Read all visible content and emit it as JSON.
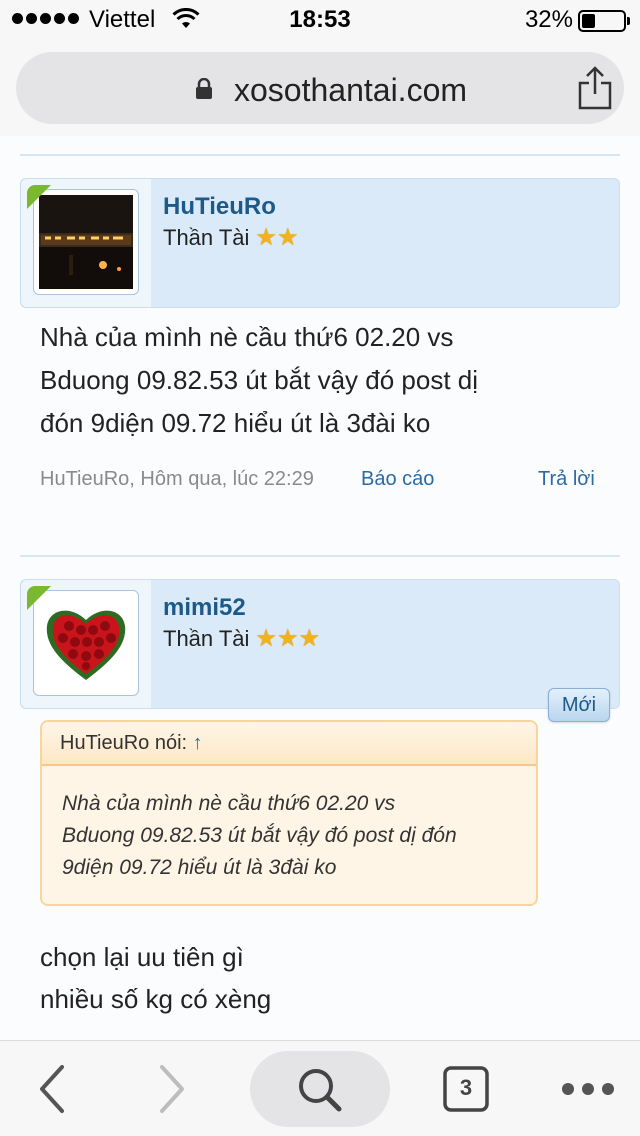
{
  "status_bar": {
    "carrier": "Viettel",
    "time": "18:53",
    "battery_percent": "32%",
    "battery_level": 0.32
  },
  "browser": {
    "url": "xosothantai.com",
    "tab_count": "3"
  },
  "posts": [
    {
      "username": "HuTieuRo",
      "rank": "Thần Tài",
      "stars": 2,
      "text_lines": [
        "Nhà của mình nè cầu thứ6 02.20 vs",
        "Bduong 09.82.53 út bắt vậy đó post dị",
        "đón 9diện 09.72 hiểu út là 3đài ko"
      ],
      "meta": "HuTieuRo, Hôm qua, lúc 22:29",
      "report_label": "Báo cáo",
      "reply_label": "Trả lời"
    },
    {
      "username": "mimi52",
      "rank": "Thần Tài",
      "stars": 3,
      "new_label": "Mới",
      "quote": {
        "author_label": "HuTieuRo nói:",
        "arrow": "↑",
        "lines": [
          "Nhà của mình nè cầu thứ6 02.20 vs",
          "Bduong 09.82.53 út bắt vậy đó post dị đón",
          "9diện 09.72 hiểu út là 3đài ko"
        ]
      },
      "text_lines": [
        "chọn lại uu tiên gì",
        "nhiều số kg có xèng"
      ]
    }
  ],
  "icons": {
    "lock": "lock-icon",
    "share": "share-icon",
    "back": "chevron-left-icon",
    "forward": "chevron-right-icon",
    "search": "search-icon",
    "tabs": "tabs-icon",
    "more": "more-icon"
  },
  "colors": {
    "link": "#2a6ba6",
    "username": "#1d5a8a",
    "user_box": "#dbeaf8",
    "quote_bg": "#fff5e6",
    "online": "#7ab82f"
  }
}
